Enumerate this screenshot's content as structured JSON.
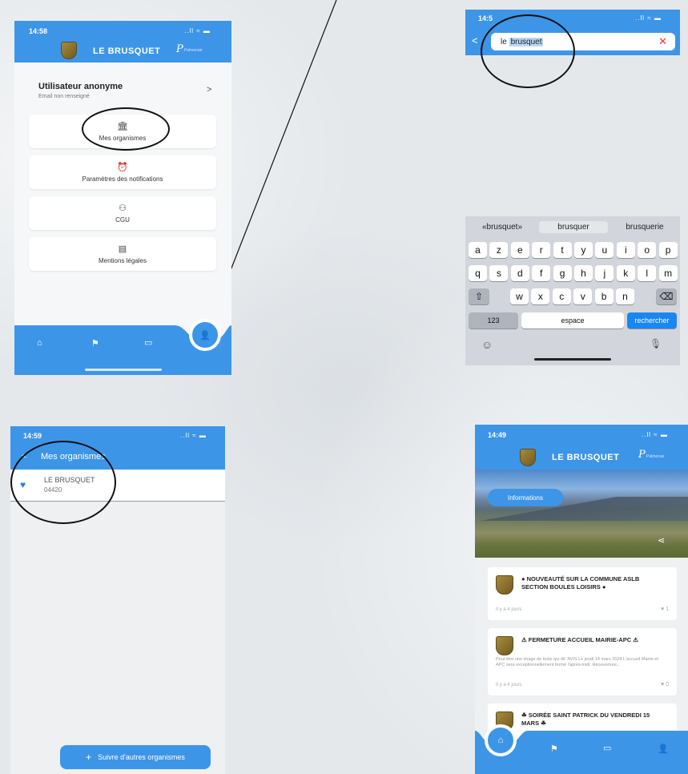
{
  "panel1": {
    "time": "14:58",
    "status_icons": "..ll ≈ ▬",
    "header_title": "LE BRUSQUET",
    "logo_text": "P",
    "logo_small": "Palmeraie",
    "user_name": "Utilisateur anonyme",
    "user_email": "Email non renseigné",
    "chevron": ">",
    "menu": [
      {
        "label": "Mes organismes",
        "icon": "🏛"
      },
      {
        "label": "Paramètres des notifications",
        "icon": "⏰"
      },
      {
        "label": "CGU",
        "icon": "⚇"
      },
      {
        "label": "Mentions légales",
        "icon": "▤"
      }
    ],
    "tabs": {
      "home": "⌂",
      "flag": "⚑",
      "chat": "▭",
      "profile": "👤"
    }
  },
  "panel2": {
    "time": "14:5",
    "status_icons": "..ll ≈ ▬",
    "back": "<",
    "search_prefix": "le ",
    "search_selected": "brusquet",
    "clear": "✕"
  },
  "keyboard": {
    "suggestions": [
      "«brusquet»",
      "brusquer",
      "brusquerie"
    ],
    "row1": [
      "a",
      "z",
      "e",
      "r",
      "t",
      "y",
      "u",
      "i",
      "o",
      "p"
    ],
    "row2": [
      "q",
      "s",
      "d",
      "f",
      "g",
      "h",
      "j",
      "k",
      "l",
      "m"
    ],
    "row3": [
      "w",
      "x",
      "c",
      "v",
      "b",
      "n"
    ],
    "shift": "⇧",
    "backspace": "⌫",
    "num": "123",
    "space": "espace",
    "go": "rechercher",
    "emoji": "☺",
    "mic": "🎙"
  },
  "panel3": {
    "time": "14:59",
    "status_icons": "..ll ≈ ▬",
    "back": "<",
    "title": "Mes organismes",
    "org_name": "LE BRUSQUET",
    "org_code": "04420",
    "heart": "♥",
    "follow_plus": "+",
    "follow_label": "Suivre d'autres organismes"
  },
  "panel4": {
    "time": "14:49",
    "status_icons": "..ll ≈ ▬",
    "header_title": "LE BRUSQUET",
    "logo_text": "P",
    "logo_small": "Palmeraie",
    "info_button": "Informations",
    "share": "⋖",
    "news": [
      {
        "title": "● NOUVEAUTÉ SUR LA COMMUNE ASLB SECTION BOULES LOISIRS ●",
        "desc": "",
        "time": "Il y a 4 jours",
        "likes": "♥ 1"
      },
      {
        "title": "⚠ FERMETURE ACCUEIL MAIRIE-APC ⚠",
        "desc": "Peut être une image de texte qui dit 'AVIS Le jeudi 14 mars 2024 L'accueil Mairie et APC sera exceptionnellement fermé l'après-midi. Réouverture...",
        "time": "Il y a 4 jours",
        "likes": "♥ 0"
      },
      {
        "title": "☘ SOIRÉE SAINT PATRICK DU VENDREDI 15 MARS ☘",
        "desc": "",
        "time": "",
        "likes": ""
      }
    ],
    "tabs": {
      "home": "⌂",
      "flag": "⚑",
      "chat": "▭",
      "profile": "👤"
    }
  }
}
